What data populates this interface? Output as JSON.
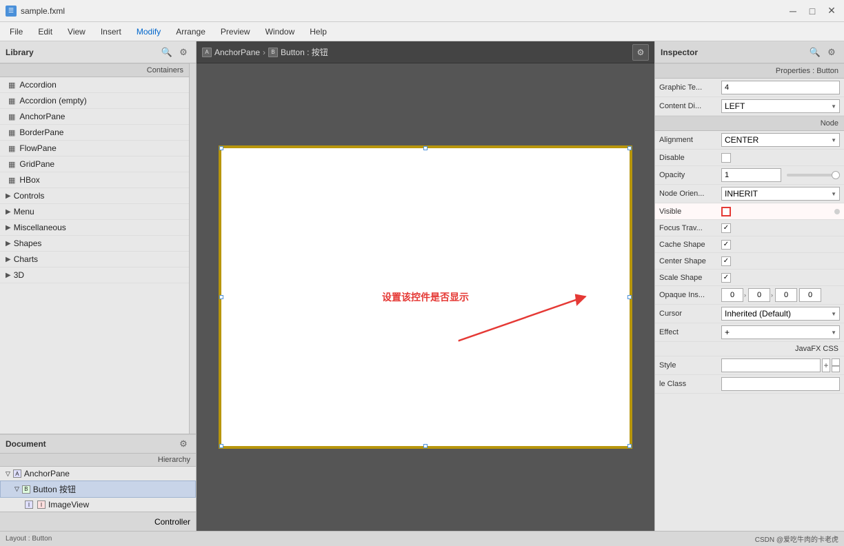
{
  "titleBar": {
    "icon": "☰",
    "title": "sample.fxml",
    "minimizeBtn": "─",
    "maximizeBtn": "□",
    "closeBtn": "✕"
  },
  "menuBar": {
    "items": [
      "File",
      "Edit",
      "View",
      "Insert",
      "Modify",
      "Arrange",
      "Preview",
      "Window",
      "Help"
    ]
  },
  "library": {
    "title": "Library",
    "searchIcon": "🔍",
    "settingsIcon": "⚙",
    "sections": {
      "containers": "Containers",
      "controls": "Controls",
      "menu": "Menu",
      "miscellaneous": "Miscellaneous",
      "shapes": "Shapes",
      "charts": "Charts",
      "threeDee": "3D"
    },
    "items": [
      {
        "label": "Accordion",
        "icon": "▦"
      },
      {
        "label": "Accordion  (empty)",
        "icon": "▦"
      },
      {
        "label": "AnchorPane",
        "icon": "▦"
      },
      {
        "label": "BorderPane",
        "icon": "▦"
      },
      {
        "label": "FlowPane",
        "icon": "▦"
      },
      {
        "label": "GridPane",
        "icon": "▦"
      },
      {
        "label": "HBox",
        "icon": "▦"
      }
    ]
  },
  "document": {
    "title": "Document",
    "settingsIcon": "⚙",
    "hierarchy": "Hierarchy",
    "items": [
      {
        "label": "AnchorPane",
        "indent": 0,
        "icons": [
          "▷",
          "▦"
        ]
      },
      {
        "label": "Button 按钮",
        "indent": 1,
        "icons": [
          "▦",
          "ok"
        ],
        "selected": true
      },
      {
        "label": "ImageView",
        "indent": 2,
        "icons": [
          "▦",
          "▦"
        ]
      }
    ],
    "controller": "Controller"
  },
  "canvas": {
    "breadcrumb": {
      "items": [
        {
          "label": "AnchorPane",
          "icon": "▦"
        },
        {
          "label": "Button : 按钮",
          "icon": "ok"
        }
      ]
    },
    "annotationText": "设置该控件是否显示"
  },
  "inspector": {
    "title": "Inspector",
    "subtitle": "Properties : Button",
    "searchIcon": "🔍",
    "settingsIcon": "⚙",
    "properties": {
      "graphicText": {
        "label": "Graphic Te...",
        "value": "4"
      },
      "contentDisplay": {
        "label": "Content Di...",
        "value": "LEFT"
      },
      "sectionNode": "Node",
      "alignment": {
        "label": "Alignment",
        "value": "CENTER"
      },
      "disable": {
        "label": "Disable",
        "checked": false
      },
      "opacity": {
        "label": "Opacity",
        "value": "1"
      },
      "nodeOrientation": {
        "label": "Node Orien...",
        "value": "INHERIT"
      },
      "visible": {
        "label": "Visible",
        "checked": false,
        "highlighted": true
      },
      "focusTrav": {
        "label": "Focus Trav...",
        "checked": true
      },
      "cacheShape": {
        "label": "Cache Shape",
        "checked": true
      },
      "centerShape": {
        "label": "Center Shape",
        "checked": true
      },
      "scaleShape": {
        "label": "Scale Shape",
        "checked": true
      },
      "opaqueIns": {
        "label": "Opaque Ins...",
        "values": [
          "0",
          "0",
          "0",
          "0"
        ]
      },
      "cursor": {
        "label": "Cursor",
        "value": "Inherited (Default)"
      },
      "effect": {
        "label": "Effect",
        "value": "+"
      },
      "javafxCss": "JavaFX CSS",
      "style": {
        "label": "Style"
      },
      "styleClass": {
        "label": "le Class"
      }
    }
  },
  "bottomBar": {
    "left": "Layout : Button",
    "right": "CSDN @爱吃牛肉的卡老虎"
  }
}
